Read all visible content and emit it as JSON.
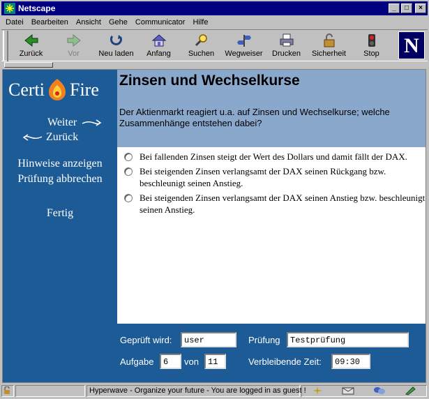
{
  "window": {
    "title": "Netscape",
    "minimize": "_",
    "maximize": "□",
    "close": "×"
  },
  "menu": [
    "Datei",
    "Bearbeiten",
    "Ansicht",
    "Gehe",
    "Communicator",
    "Hilfe"
  ],
  "toolbar": [
    {
      "label": "Zurück",
      "icon": "back-arrow-icon",
      "enabled": true
    },
    {
      "label": "Vor",
      "icon": "forward-arrow-icon",
      "enabled": false
    },
    {
      "label": "Neu laden",
      "icon": "reload-icon",
      "enabled": true
    },
    {
      "label": "Anfang",
      "icon": "home-icon",
      "enabled": true
    },
    {
      "label": "Suchen",
      "icon": "search-icon",
      "enabled": true
    },
    {
      "label": "Wegweiser",
      "icon": "guide-icon",
      "enabled": true
    },
    {
      "label": "Drucken",
      "icon": "print-icon",
      "enabled": true
    },
    {
      "label": "Sicherheit",
      "icon": "lock-icon",
      "enabled": true
    },
    {
      "label": "Stop",
      "icon": "stop-icon",
      "enabled": true
    }
  ],
  "logo": {
    "letter": "N"
  },
  "sidebar": {
    "brand_left": "Certi",
    "brand_right": "Fire",
    "next": "Weiter",
    "back": "Zurück",
    "hints": "Hinweise anzeigen",
    "abort": "Prüfung abbrechen",
    "done": "Fertig"
  },
  "question": {
    "title": "Zinsen und Wechselkurse",
    "text": "Der Aktienmarkt reagiert u.a. auf Zinsen und Wechselkurse; welche Zusammenhänge entstehen dabei?",
    "options": [
      "Bei fallenden Zinsen steigt der Wert des Dollars und damit fällt der DAX.",
      "Bei steigenden Zinsen verlangsamt der DAX seinen Rückgang bzw. beschleunigt seinen Anstieg.",
      "Bei steigenden Zinsen verlangsamt der DAX seinen Anstieg bzw. beschleunigt seinen Anstieg."
    ]
  },
  "footer": {
    "examinee_label": "Geprüft wird:",
    "examinee_value": "user",
    "exam_label": "Prüfung",
    "exam_value": "Testprüfung",
    "task_label": "Aufgabe",
    "task_value": "6",
    "of_label": "von",
    "of_value": "11",
    "time_label": "Verbleibende Zeit:",
    "time_value": "09:30"
  },
  "status": {
    "text": "Hyperwave - Organize your future - You are logged in as guest !"
  },
  "colors": {
    "titlebar": "#000080",
    "sidebar": "#1d5b96",
    "header": "#8aa8cc",
    "chrome": "#c0c0c0"
  }
}
